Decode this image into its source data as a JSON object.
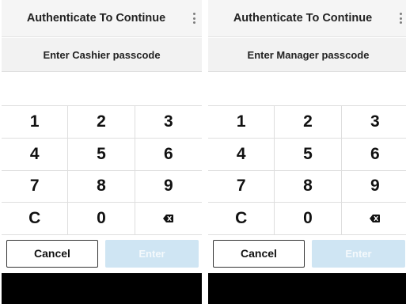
{
  "panels": [
    {
      "header": {
        "title": "Authenticate To Continue",
        "menu_icon": "kebab-menu-icon"
      },
      "prompt": "Enter Cashier passcode",
      "keypad": [
        "1",
        "2",
        "3",
        "4",
        "5",
        "6",
        "7",
        "8",
        "9",
        "C",
        "0",
        "backspace-icon"
      ],
      "cancel_label": "Cancel",
      "enter_label": "Enter"
    },
    {
      "header": {
        "title": "Authenticate To Continue",
        "menu_icon": "kebab-menu-icon"
      },
      "prompt": "Enter Manager passcode",
      "keypad": [
        "1",
        "2",
        "3",
        "4",
        "5",
        "6",
        "7",
        "8",
        "9",
        "C",
        "0",
        "backspace-icon"
      ],
      "cancel_label": "Cancel",
      "enter_label": "Enter"
    }
  ],
  "colors": {
    "header_bg": "#f5f5f5",
    "enter_disabled_bg": "#cfe5f3",
    "bottom_bar": "#000000"
  }
}
